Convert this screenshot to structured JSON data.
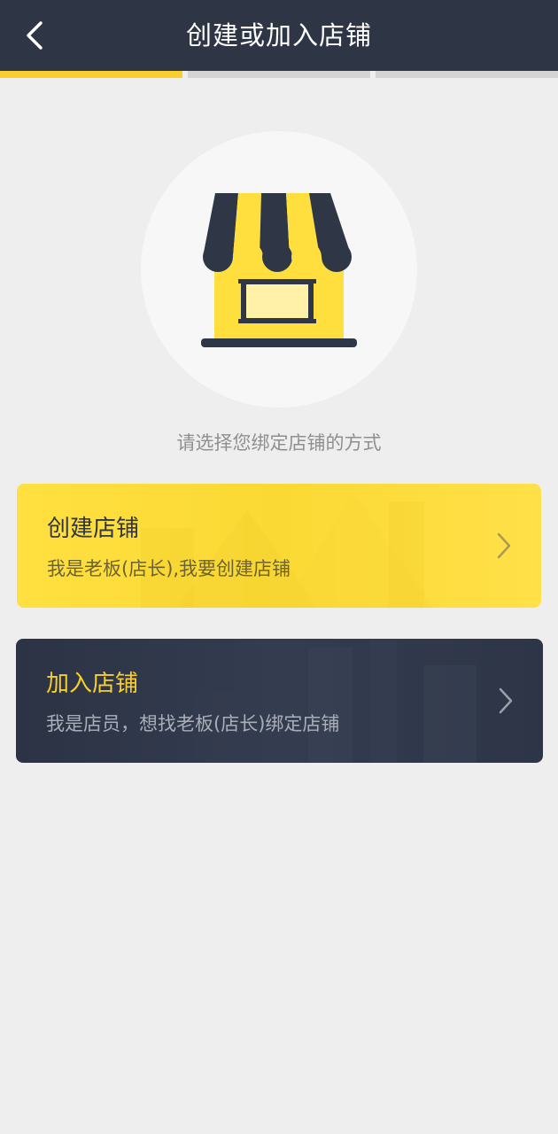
{
  "header": {
    "title": "创建或加入店铺"
  },
  "steps": {
    "total": 3,
    "current": 1,
    "colors": {
      "active": "#f8cf2c",
      "inactive": "#d4d4d4"
    }
  },
  "hero": {
    "icon": "storefront-icon"
  },
  "prompt": "请选择您绑定店铺的方式",
  "options": [
    {
      "title": "创建店铺",
      "subtitle": "我是老板(店长),我要创建店铺",
      "icon": "chevron-right-icon"
    },
    {
      "title": "加入店铺",
      "subtitle": "我是店员，想找老板(店长)绑定店铺",
      "icon": "chevron-right-icon"
    }
  ],
  "colors": {
    "header_bg": "#2e3545",
    "accent_yellow": "#f8cf2c",
    "page_bg": "#eeeeee"
  }
}
